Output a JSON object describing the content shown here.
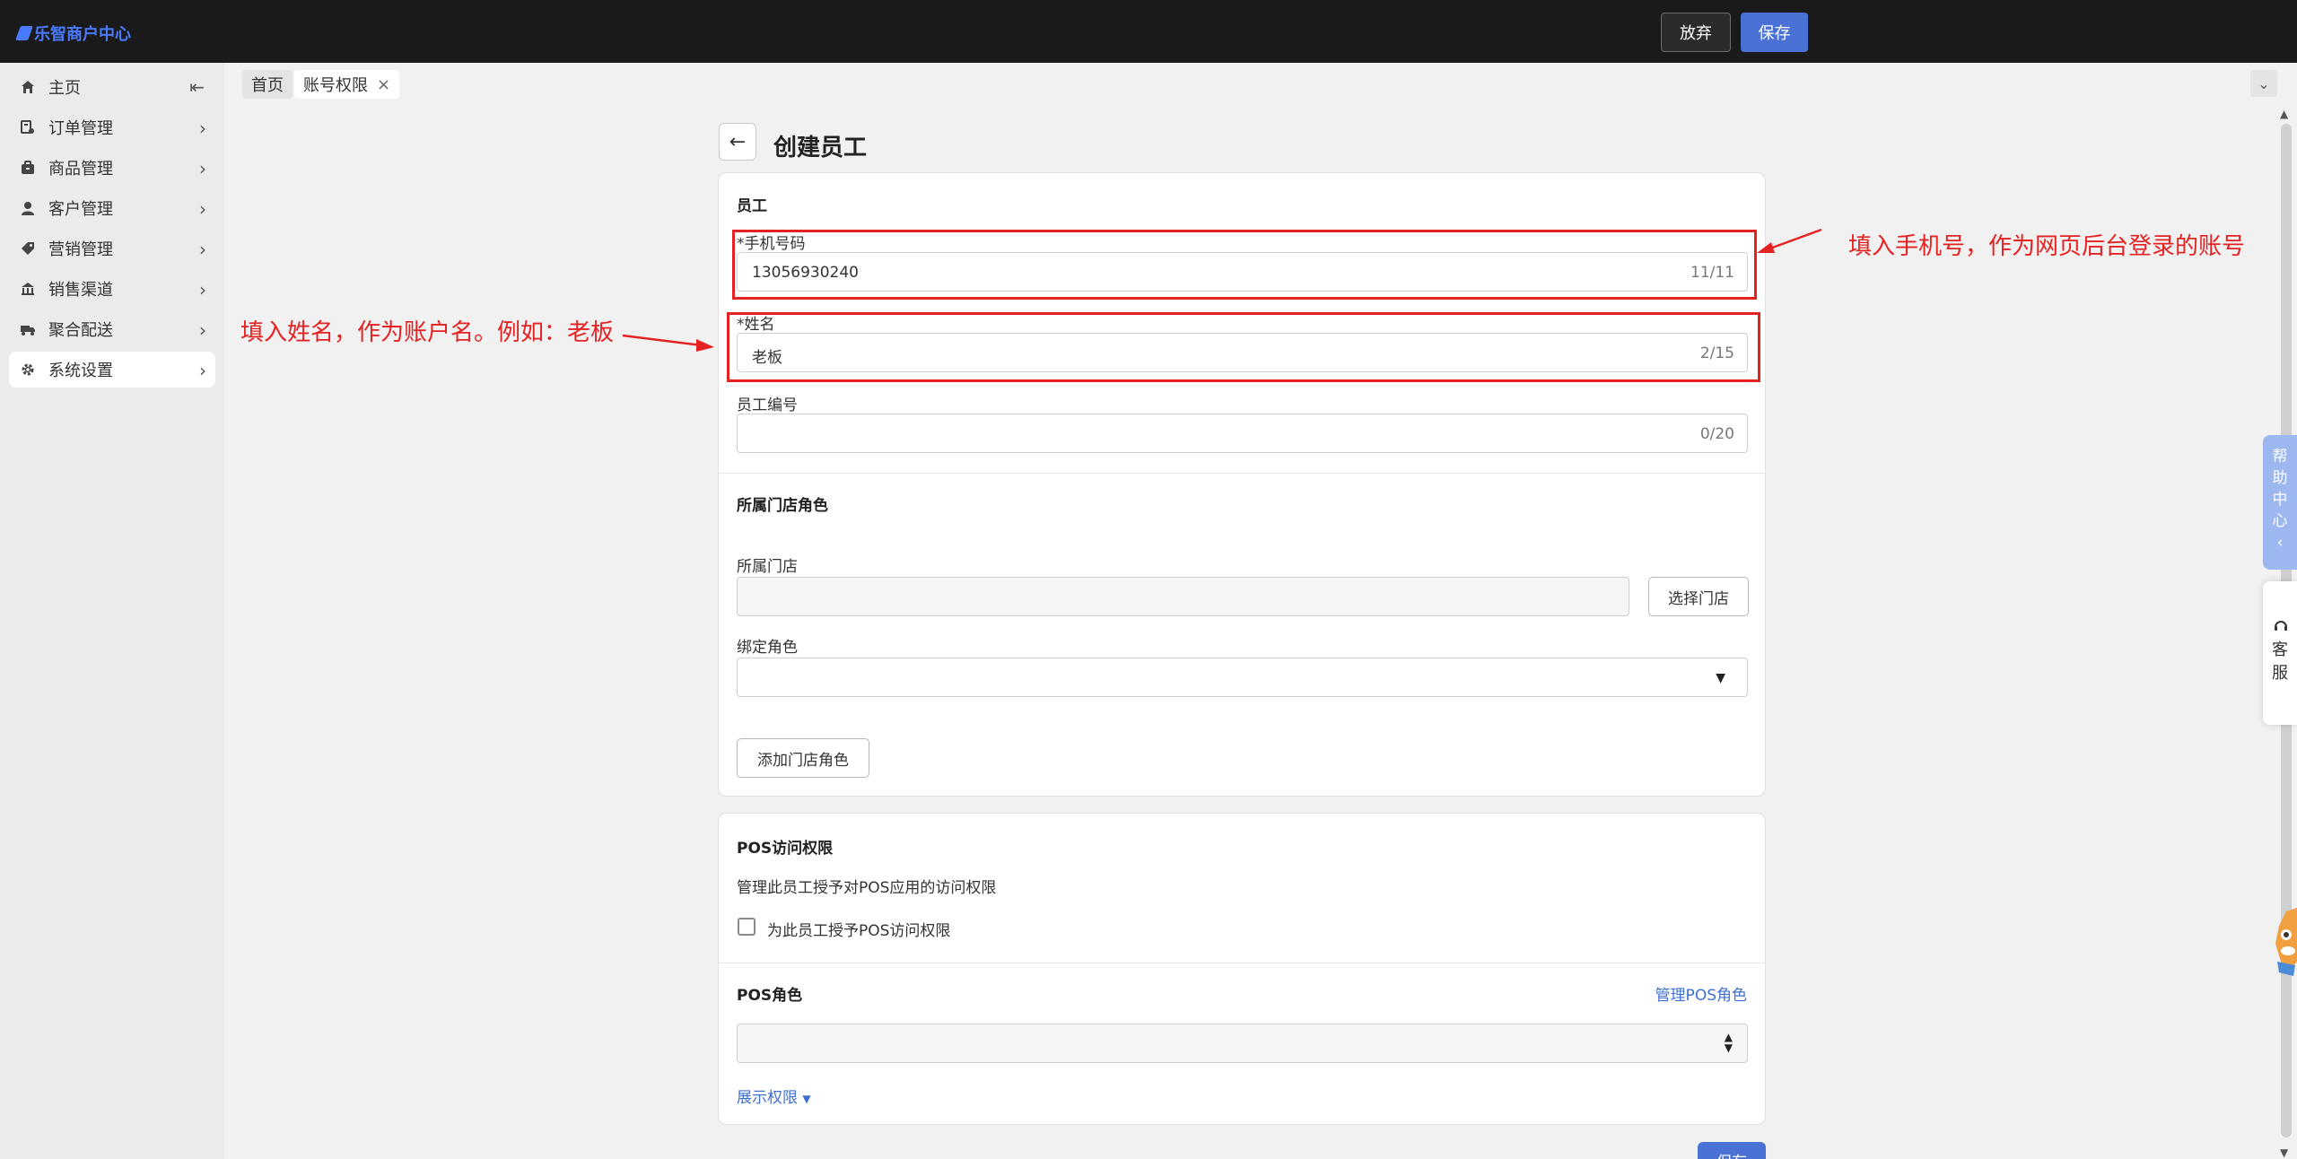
{
  "topbar": {
    "logo": "乐智商户中心",
    "discard_label": "放弃",
    "save_label": "保存"
  },
  "sidebar": {
    "items": [
      {
        "label": "主页",
        "icon": "home-icon"
      },
      {
        "label": "订单管理",
        "icon": "order-icon"
      },
      {
        "label": "商品管理",
        "icon": "goods-icon"
      },
      {
        "label": "客户管理",
        "icon": "customer-icon"
      },
      {
        "label": "营销管理",
        "icon": "tag-icon"
      },
      {
        "label": "销售渠道",
        "icon": "store-icon"
      },
      {
        "label": "聚合配送",
        "icon": "delivery-icon"
      },
      {
        "label": "系统设置",
        "icon": "gear-icon"
      }
    ]
  },
  "tabs": [
    {
      "label": "首页"
    },
    {
      "label": "账号权限"
    }
  ],
  "page": {
    "title": "创建员工"
  },
  "employee": {
    "section": "员工",
    "phone_label": "*手机号码",
    "phone_value": "13056930240",
    "phone_count": "11/11",
    "name_label": "*姓名",
    "name_value": "老板",
    "name_count": "2/15",
    "number_label": "员工编号",
    "number_value": "",
    "number_count": "0/20"
  },
  "store_role": {
    "section": "所属门店角色",
    "store_label": "所属门店",
    "select_store_button": "选择门店",
    "role_label": "绑定角色",
    "add_role_button": "添加门店角色"
  },
  "pos": {
    "section": "POS访问权限",
    "desc": "管理此员工授予对POS应用的访问权限",
    "checkbox_label": "为此员工授予POS访问权限",
    "role_section": "POS角色",
    "manage_link": "管理POS角色",
    "show_permissions": "展示权限",
    "next_button": "保存"
  },
  "annotations": {
    "phone_note": "填入手机号，作为网页后台登录的账号",
    "name_note": "填入姓名，作为账户名。例如：老板"
  },
  "widgets": {
    "help_center": [
      "帮",
      "助",
      "中",
      "心"
    ],
    "customer_service": [
      "客",
      "服"
    ]
  },
  "colors": {
    "accent": "#4a72d6",
    "annotation": "#e52222",
    "topbar": "#1a1a1a"
  }
}
